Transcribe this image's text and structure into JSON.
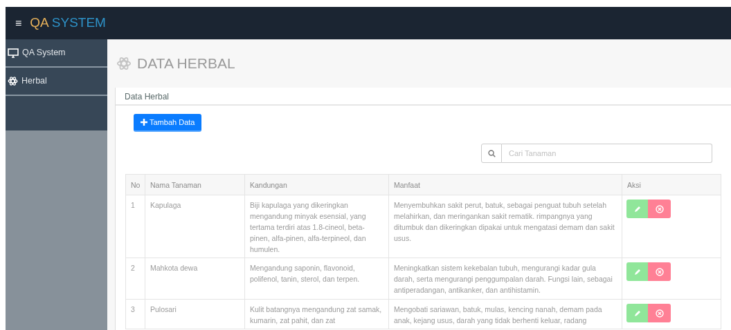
{
  "navbar": {
    "menu_icon": "≡",
    "brand_first": "QA",
    "brand_second": "SYSTEM"
  },
  "sidebar": {
    "items": [
      {
        "label": "QA System",
        "kind": "monitor",
        "selected": false
      },
      {
        "label": "Herbal",
        "kind": "atom",
        "selected": false
      }
    ]
  },
  "page": {
    "title": "DATA HERBAL"
  },
  "panel": {
    "title": "Data Herbal",
    "add_button": "Tambah Data",
    "search": {
      "placeholder": "Cari Tanaman"
    }
  },
  "table": {
    "columns": [
      "No",
      "Nama Tanaman",
      "Kandungan",
      "Manfaat",
      "Aksi"
    ],
    "rows": [
      {
        "no": "1",
        "name": "Kapulaga",
        "kandungan": "Biji kapulaga yang dikeringkan mengandung minyak esensial, yang tertama terdiri atas 1.8-cineol, beta-pinen, alfa-pinen, alfa-terpineol, dan humulen.",
        "manfaat": "Menyembuhkan sakit perut, batuk, sebagai penguat tubuh setelah melahirkan, dan meringankan sakit rematik. rimpangnya yang ditumbuk dan dikeringkan dipakai untuk mengatasi demam dan sakit usus."
      },
      {
        "no": "2",
        "name": "Mahkota dewa",
        "kandungan": "Mengandung saponin, flavonoid, polifenol, tanin, sterol, dan terpen.",
        "manfaat": "Meningkatkan sistem kekebalan tubuh, mengurangi kadar gula darah, serta mengurangi penggumpalan darah. Fungsi lain, sebagai antiperadangan, antikanker, dan antihistamin."
      },
      {
        "no": "3",
        "name": "Pulosari",
        "kandungan": "Kulit batangnya mengandung zat samak, kumarin, zat pahit, dan zat",
        "manfaat": "Mengobati sariawan, batuk, mulas, kencing nanah, demam pada anak, kejang usus, darah yang tidak berhenti keluar, radang"
      }
    ]
  }
}
